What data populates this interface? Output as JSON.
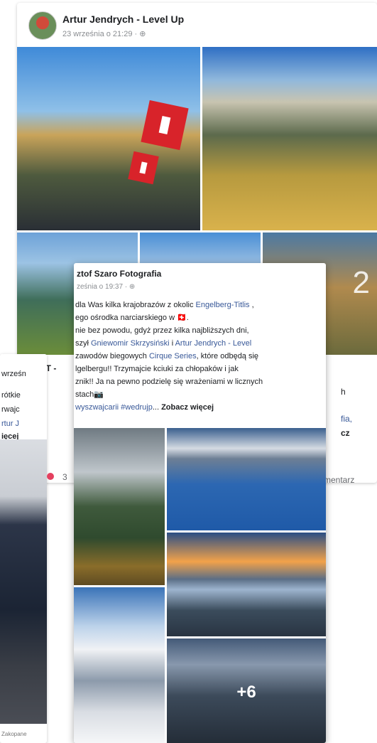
{
  "post_main": {
    "author": "Artur Jendrych - Level Up",
    "timestamp": "23 września o 21:29 · ⊕",
    "photo_more": "2",
    "frag_author": "UT -",
    "frag_left_1": "rótkie",
    "frag_left_2": "rwajc",
    "frag_left_3": "rtur J",
    "frag_left_4": "ięcej",
    "frag_right_1": "fia,",
    "frag_right_2": "cz",
    "frag_right_3": "h",
    "comment_frag": "mentarz",
    "reaction_count": "3"
  },
  "post_front": {
    "author": "ztof Szaro Fotografia",
    "timestamp": "ześnia o 19:37 · ⊕",
    "lines": [
      [
        "dla Was kilka krajobrazów z okolic ",
        "Engelberg-Titlis",
        " ,"
      ],
      [
        "ego ośrodka narciarskiego w 🇨🇭."
      ],
      [
        "nie bez powodu, gdyż przez kilka najbliższych dni,"
      ],
      [
        "szył ",
        "Gniewomir Skrzysiński",
        " i ",
        "Artur Jendrych - Level"
      ],
      [
        " zawodów biegowych ",
        "Cirque Series",
        ", które odbędą się"
      ],
      [
        "lgelbergu!! Trzymajcie kciuki za chłopaków i jak"
      ],
      [
        "znik!! Ja na pewno podzielę się wrażeniami w licznych"
      ],
      [
        "stach📷"
      ],
      [
        "wyszwajcarii #wedrujp",
        "... ",
        "Zobacz więcej"
      ]
    ],
    "more_count": "+6"
  },
  "post_left": {
    "frag_1": "wrześn",
    "caption": "Zakopane"
  }
}
